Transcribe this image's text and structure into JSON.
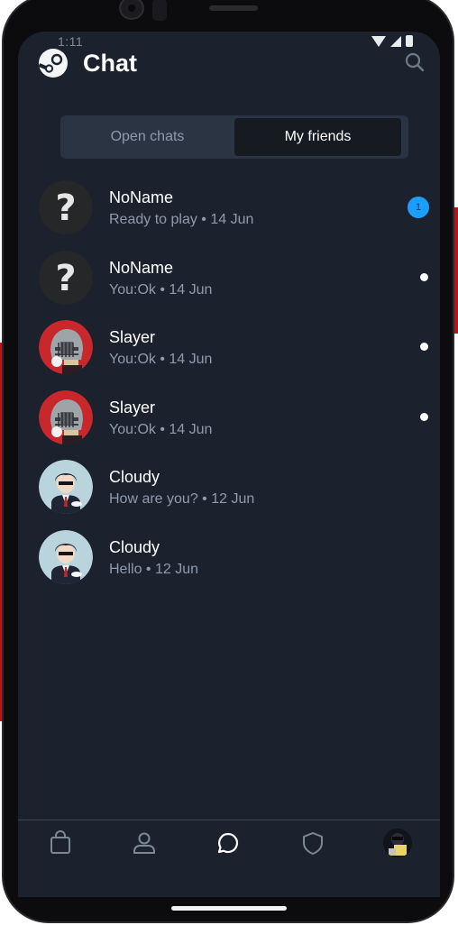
{
  "status_bar": {
    "time": "1:11"
  },
  "header": {
    "title": "Chat"
  },
  "tabs": {
    "open_chats": "Open chats",
    "my_friends": "My friends",
    "active": "my_friends"
  },
  "chats": [
    {
      "name": "NoName",
      "meta": "Ready to play • 14 Jun",
      "avatar": "question",
      "indicator": "badge",
      "badge_count": "1"
    },
    {
      "name": "NoName",
      "meta": "You:Ok • 14 Jun",
      "avatar": "question",
      "indicator": "dot"
    },
    {
      "name": "Slayer",
      "meta": "You:Ok • 14 Jun",
      "avatar": "knight",
      "indicator": "dot"
    },
    {
      "name": "Slayer",
      "meta": "You:Ok • 14 Jun",
      "avatar": "knight",
      "indicator": "dot"
    },
    {
      "name": "Cloudy",
      "meta": "How are you? • 12 Jun",
      "avatar": "suit",
      "indicator": "none"
    },
    {
      "name": "Cloudy",
      "meta": "Hello • 12 Jun",
      "avatar": "suit",
      "indicator": "none"
    }
  ],
  "bottom_nav": [
    "store-icon",
    "profile-icon",
    "chat-icon",
    "guard-icon",
    "user-avatar"
  ],
  "colors": {
    "background": "#1b222d",
    "accent": "#1a9fff",
    "tab_bg": "#2a3443",
    "tab_active": "#161b22",
    "meta_text": "#8f9bad"
  }
}
